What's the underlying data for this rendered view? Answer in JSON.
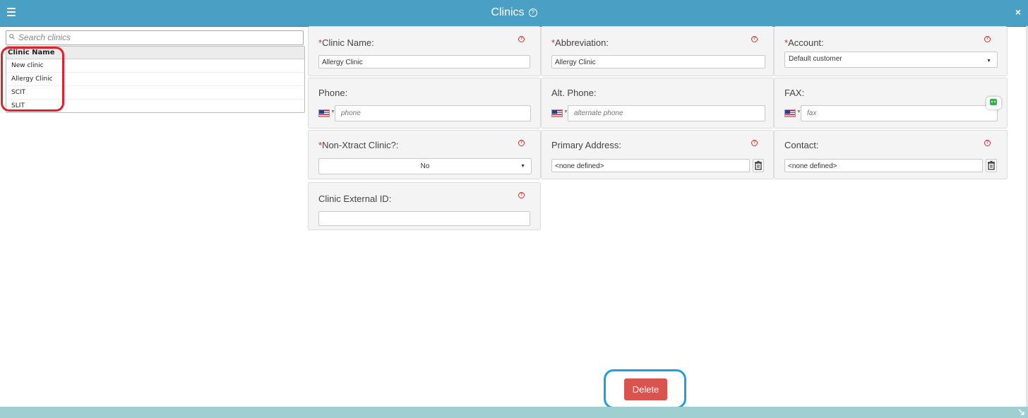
{
  "window": {
    "title": "Clinics",
    "title_help_icon": "help-icon",
    "help_glyph": "?",
    "close_glyph": "×"
  },
  "search": {
    "placeholder": "Search clinics"
  },
  "clinic_list": {
    "header": "Clinic Name",
    "rows": [
      "New clinic",
      "Allergy Clinic",
      "SCIT",
      "SLIT"
    ]
  },
  "form": {
    "clinic_name": {
      "required_mark": "*",
      "label": "Clinic Name:",
      "value": "Allergy Clinic"
    },
    "abbreviation": {
      "required_mark": "*",
      "label": "Abbreviation:",
      "value": "Allergy Clinic"
    },
    "account": {
      "required_mark": "*",
      "label": "Account:",
      "value": "Default customer"
    },
    "phone": {
      "label": "Phone:",
      "placeholder": "phone",
      "country_flag": "us-flag"
    },
    "alt_phone": {
      "label": "Alt. Phone:",
      "placeholder": "alternate phone",
      "country_flag": "us-flag"
    },
    "fax": {
      "label": "FAX:",
      "placeholder": "fax",
      "country_flag": "us-flag"
    },
    "non_xtract": {
      "required_mark": "*",
      "label": "Non-Xtract Clinic?:",
      "value": "No"
    },
    "primary_address": {
      "label": "Primary Address:",
      "value": "<none defined>"
    },
    "contact": {
      "label": "Contact:",
      "value": "<none defined>"
    },
    "external_id": {
      "label": "Clinic External ID:",
      "value": ""
    }
  },
  "actions": {
    "delete_label": "Delete"
  },
  "colors": {
    "titlebar": "#4a9fc4",
    "footerbar": "#9fcfd0",
    "delete": "#d9534f",
    "required": "#d9302c",
    "annotation_red": "#e3202a",
    "annotation_blue": "#1e9fe0"
  }
}
